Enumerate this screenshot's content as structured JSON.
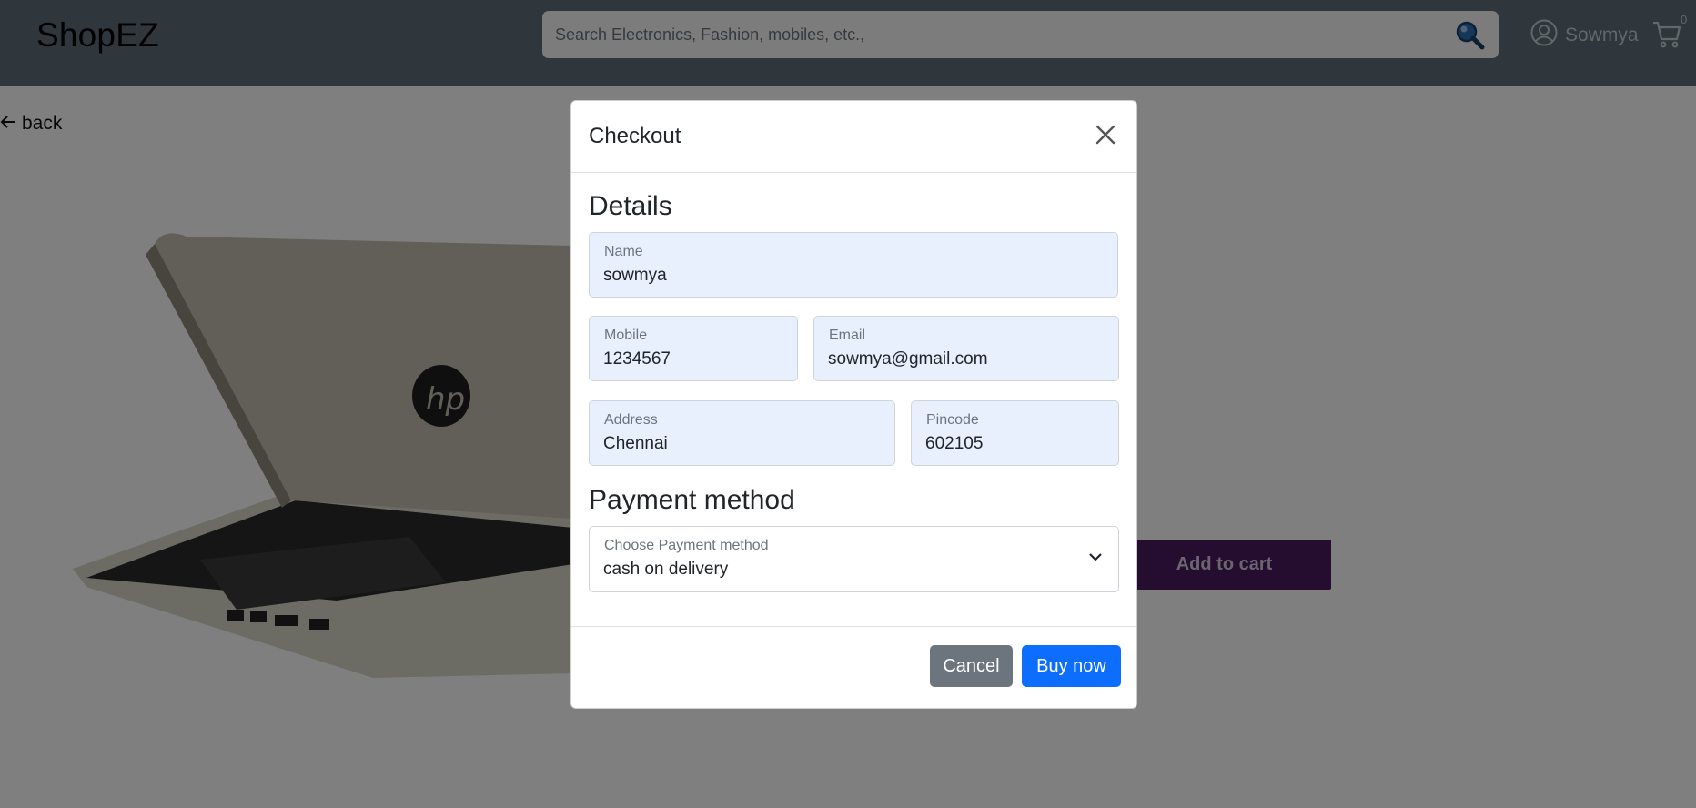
{
  "navbar": {
    "brand": "ShopEZ",
    "search_placeholder": "Search Electronics, Fashion, mobiles, etc.,",
    "username": "Sowmya",
    "cart_count": "0"
  },
  "page": {
    "back_label": "back",
    "add_to_cart_label": "Add to cart"
  },
  "modal": {
    "title": "Checkout",
    "details_heading": "Details",
    "fields": {
      "name": {
        "label": "Name",
        "value": "sowmya"
      },
      "mobile": {
        "label": "Mobile",
        "value": "1234567"
      },
      "email": {
        "label": "Email",
        "value": "sowmya@gmail.com"
      },
      "address": {
        "label": "Address",
        "value": "Chennai"
      },
      "pincode": {
        "label": "Pincode",
        "value": "602105"
      }
    },
    "payment_heading": "Payment method",
    "payment": {
      "label": "Choose Payment method",
      "value": "cash on delivery"
    },
    "cancel_label": "Cancel",
    "buy_label": "Buy now"
  },
  "icons": [
    "search-icon",
    "user-icon",
    "cart-icon",
    "arrow-left-icon",
    "close-icon",
    "chevron-down-icon",
    "chevron-left-icon"
  ],
  "colors": {
    "navbar": "#5e6e79",
    "input_fill": "#e8f0fe",
    "primary": "#0d6efd",
    "secondary": "#6c757d",
    "add_to_cart": "#4a1a5e"
  }
}
